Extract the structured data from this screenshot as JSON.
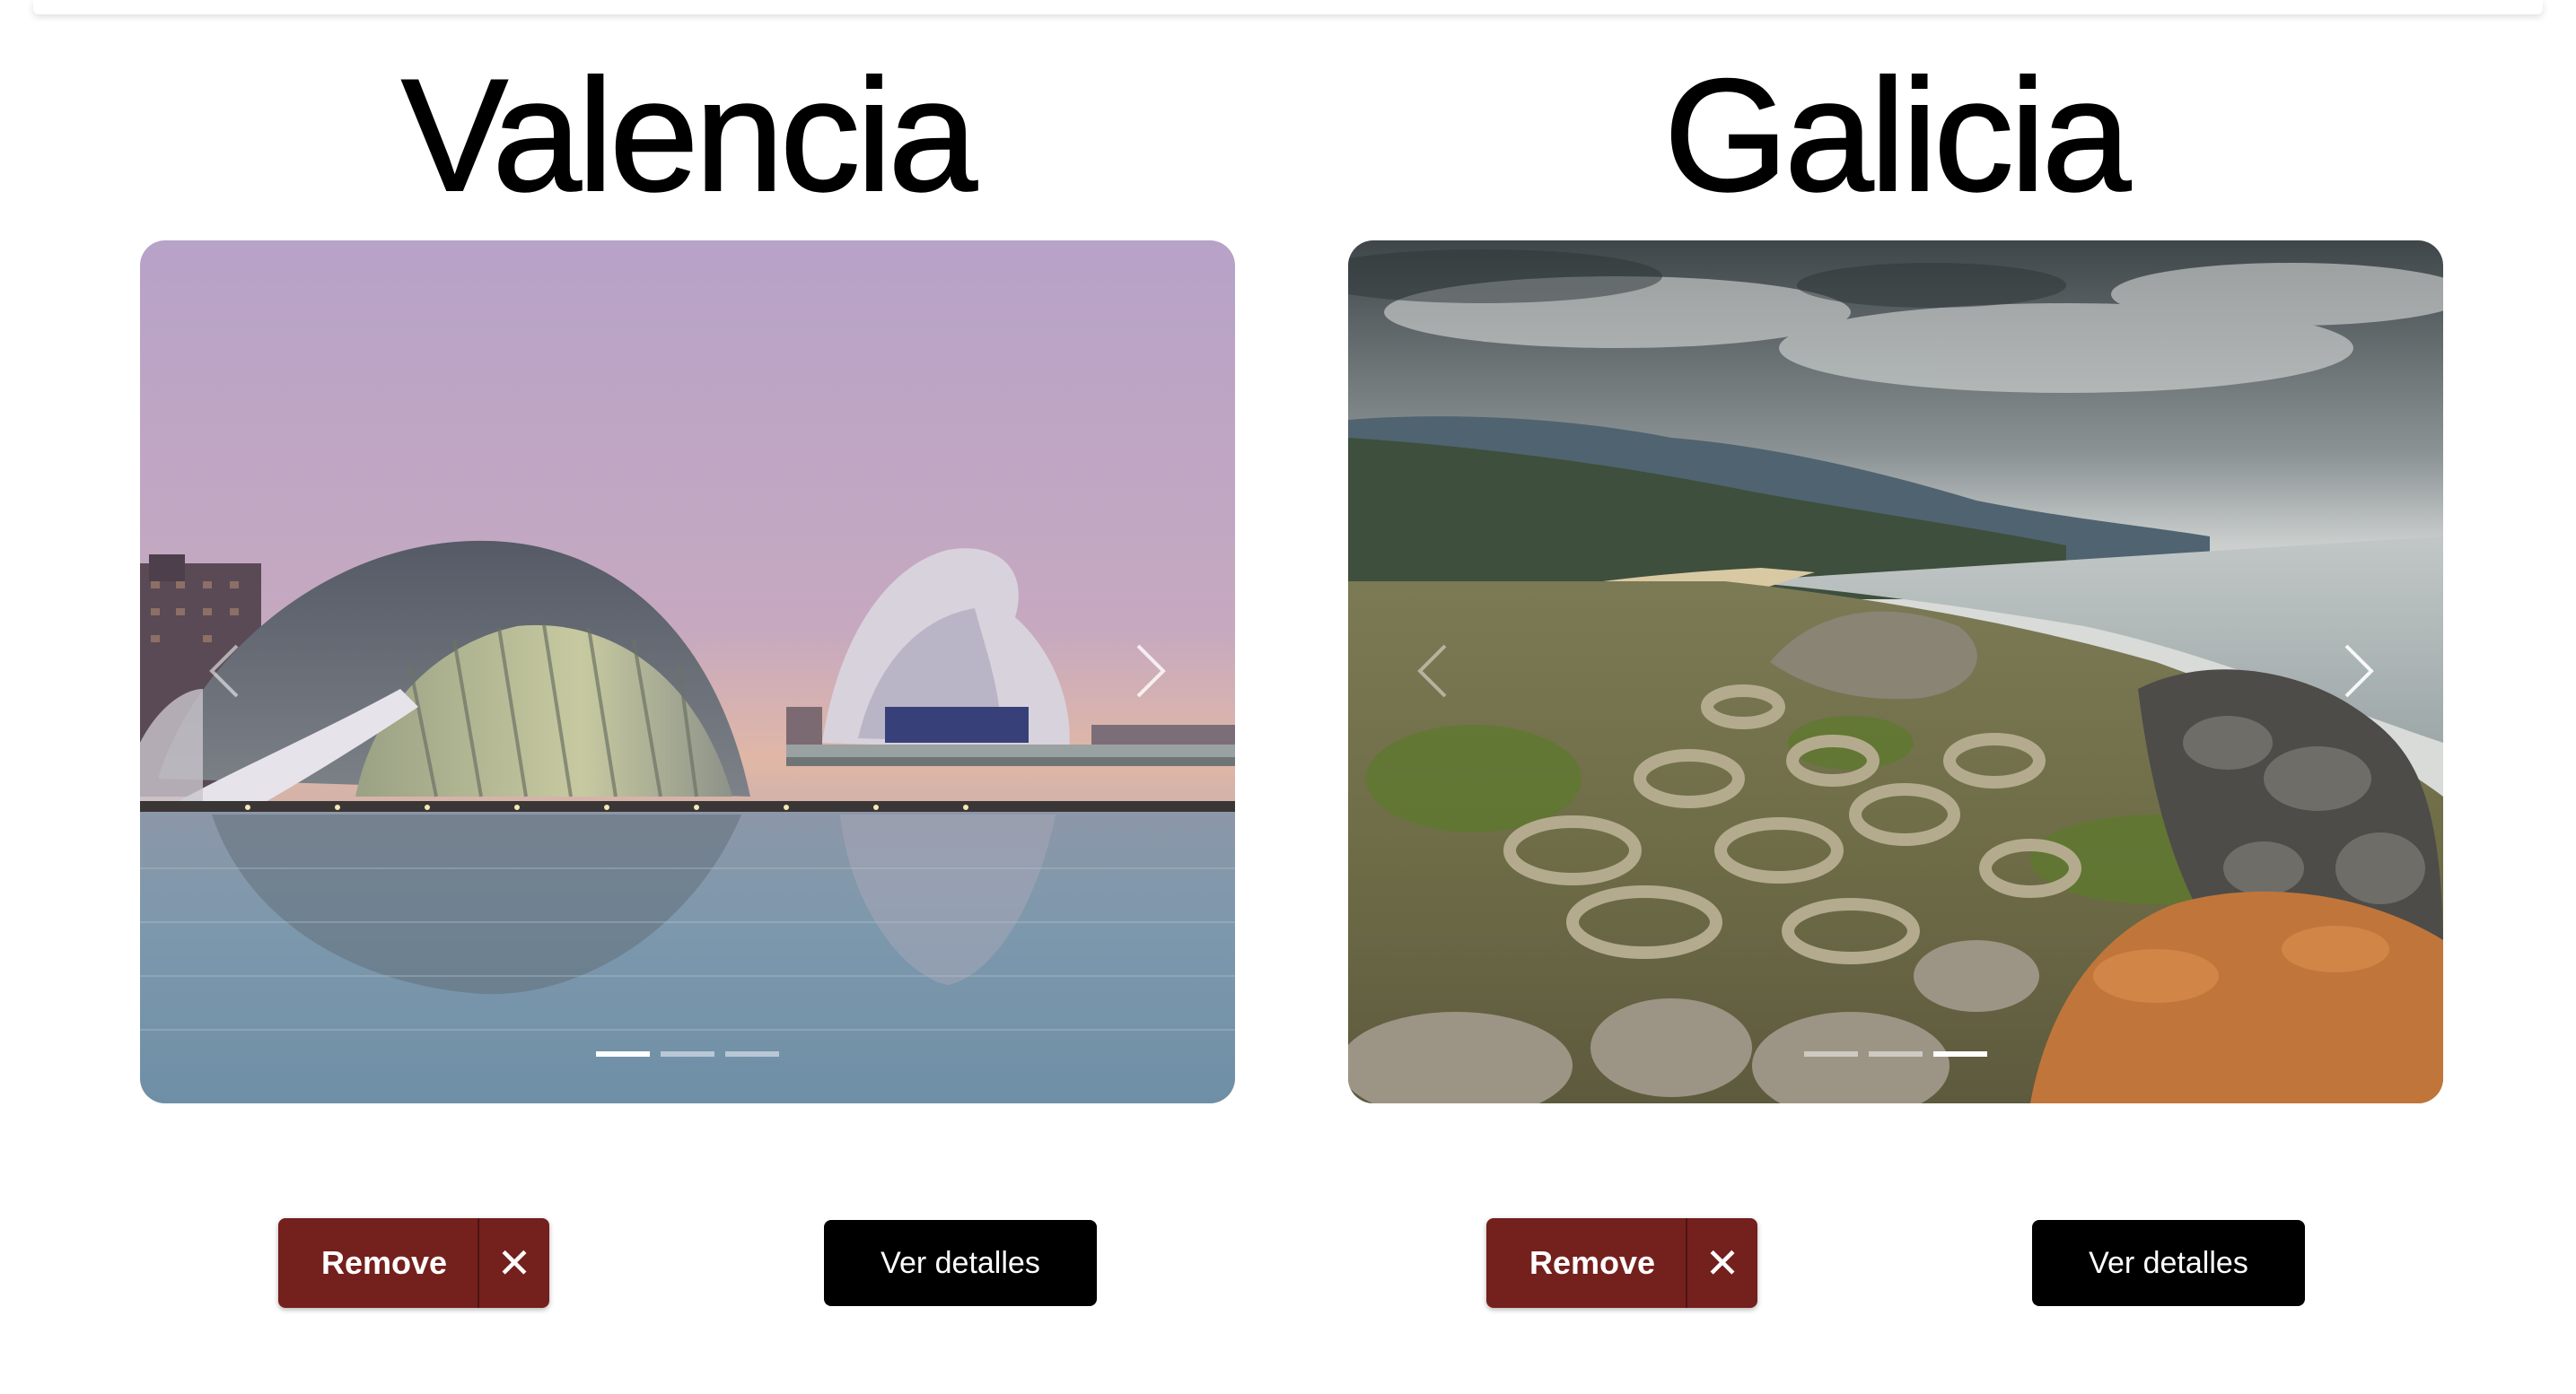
{
  "cards": [
    {
      "title": "Valencia",
      "remove_label": "Remove",
      "remove_icon": "✕",
      "details_label": "Ver detalles",
      "slides": 3,
      "active_slide": 1
    },
    {
      "title": "Galicia",
      "remove_label": "Remove",
      "remove_icon": "✕",
      "details_label": "Ver detalles",
      "slides": 3,
      "active_slide": 3
    }
  ],
  "colors": {
    "remove_button": "#74201d",
    "details_button": "#000000"
  },
  "icons": {
    "prev": "chevron-left-icon",
    "next": "chevron-right-icon",
    "close": "close-icon"
  }
}
